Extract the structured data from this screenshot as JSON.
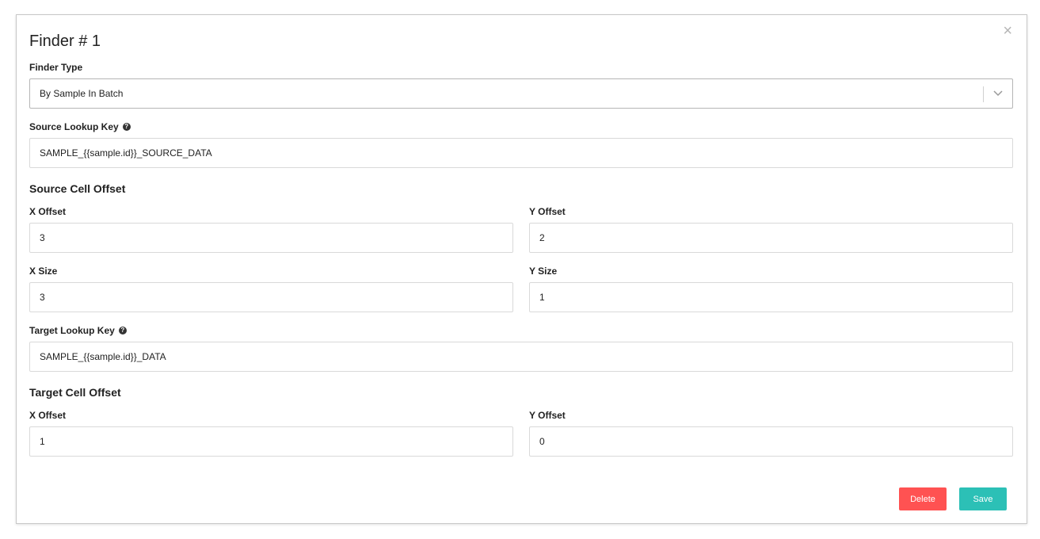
{
  "dialog": {
    "title": "Finder # 1",
    "close_glyph": "×"
  },
  "finder_type": {
    "label": "Finder Type",
    "value": "By Sample In Batch"
  },
  "source_lookup_key": {
    "label": "Source Lookup Key",
    "help_glyph": "?",
    "value": "SAMPLE_{{sample.id}}_SOURCE_DATA"
  },
  "source_cell_offset": {
    "title": "Source Cell Offset",
    "x_offset": {
      "label": "X Offset",
      "value": "3"
    },
    "y_offset": {
      "label": "Y Offset",
      "value": "2"
    },
    "x_size": {
      "label": "X Size",
      "value": "3"
    },
    "y_size": {
      "label": "Y Size",
      "value": "1"
    }
  },
  "target_lookup_key": {
    "label": "Target Lookup Key",
    "help_glyph": "?",
    "value": "SAMPLE_{{sample.id}}_DATA"
  },
  "target_cell_offset": {
    "title": "Target Cell Offset",
    "x_offset": {
      "label": "X Offset",
      "value": "1"
    },
    "y_offset": {
      "label": "Y Offset",
      "value": "0"
    }
  },
  "actions": {
    "delete_label": "Delete",
    "save_label": "Save"
  },
  "colors": {
    "delete": "#ff5252",
    "save": "#2cc0b6"
  }
}
